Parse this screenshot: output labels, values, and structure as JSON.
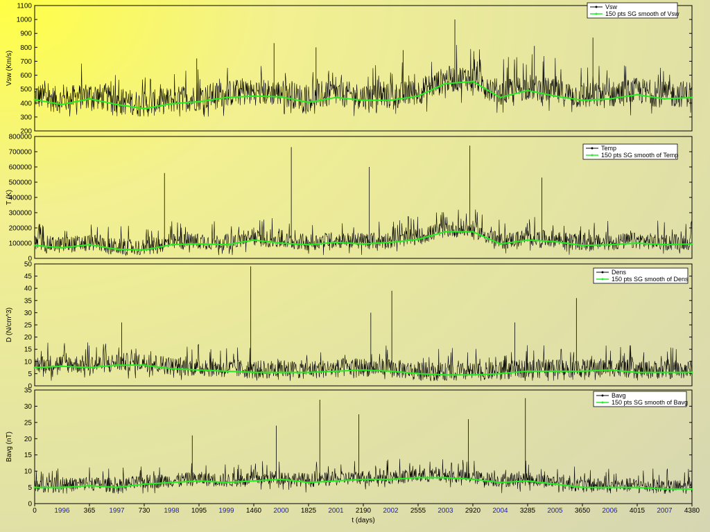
{
  "chart_data": {
    "type": "line",
    "x_axis": {
      "label": "t (days)",
      "range": [
        0,
        4380
      ],
      "ticks": [
        "0",
        "365",
        "730",
        "1095",
        "1460",
        "1825",
        "2190",
        "2555",
        "2920",
        "3285",
        "3650",
        "4015",
        "4380"
      ],
      "tick_values": [
        0,
        365,
        730,
        1095,
        1460,
        1825,
        2190,
        2555,
        2920,
        3285,
        3650,
        4015,
        4380
      ],
      "year_labels": [
        "1996",
        "1997",
        "1998",
        "1999",
        "2000",
        "2001",
        "2002",
        "2003",
        "2004",
        "2005",
        "2006",
        "2007"
      ],
      "year_values": [
        182.5,
        547.5,
        912.5,
        1277.5,
        1642.5,
        2007.5,
        2372.5,
        2737.5,
        3102.5,
        3467.5,
        3832.5,
        4197.5
      ]
    },
    "panels": [
      {
        "ylabel": "Vsw (Km/s)",
        "ylim": [
          200,
          1100
        ],
        "yticks": [
          "200",
          "300",
          "400",
          "500",
          "600",
          "700",
          "800",
          "900",
          "1000",
          "1100"
        ],
        "ytick_values": [
          200,
          300,
          400,
          500,
          600,
          700,
          800,
          900,
          1000,
          1100
        ],
        "legend": [
          "Vsw",
          "150 pts SG smooth of Vsw"
        ],
        "raw_band": {
          "min": 300,
          "max": 650
        },
        "spikes": [
          {
            "x": 1080,
            "y": 720
          },
          {
            "x": 1595,
            "y": 830
          },
          {
            "x": 1875,
            "y": 800
          },
          {
            "x": 2455,
            "y": 780
          },
          {
            "x": 2800,
            "y": 1000
          },
          {
            "x": 3330,
            "y": 810
          },
          {
            "x": 3720,
            "y": 870
          }
        ],
        "smooth": [
          [
            0,
            425
          ],
          [
            182,
            390
          ],
          [
            365,
            430
          ],
          [
            547,
            390
          ],
          [
            730,
            360
          ],
          [
            912,
            395
          ],
          [
            1095,
            410
          ],
          [
            1277,
            440
          ],
          [
            1460,
            450
          ],
          [
            1642,
            445
          ],
          [
            1825,
            405
          ],
          [
            2007,
            440
          ],
          [
            2190,
            420
          ],
          [
            2372,
            420
          ],
          [
            2555,
            450
          ],
          [
            2737,
            540
          ],
          [
            2920,
            555
          ],
          [
            3102,
            440
          ],
          [
            3285,
            490
          ],
          [
            3467,
            450
          ],
          [
            3650,
            420
          ],
          [
            3832,
            430
          ],
          [
            4015,
            460
          ],
          [
            4197,
            430
          ],
          [
            4380,
            440
          ]
        ]
      },
      {
        "ylabel": "T (K)",
        "ylim": [
          0,
          800000
        ],
        "yticks": [
          "0",
          "100000",
          "200000",
          "300000",
          "400000",
          "500000",
          "600000",
          "700000",
          "800000"
        ],
        "ytick_values": [
          0,
          100000,
          200000,
          300000,
          400000,
          500000,
          600000,
          700000,
          800000
        ],
        "legend": [
          "Temp",
          "150 pts SG smooth of Temp"
        ],
        "raw_band": {
          "min": 20000,
          "max": 220000
        },
        "spikes": [
          {
            "x": 865,
            "y": 560000
          },
          {
            "x": 1710,
            "y": 730000
          },
          {
            "x": 2230,
            "y": 600000
          },
          {
            "x": 2900,
            "y": 740000
          },
          {
            "x": 3380,
            "y": 530000
          }
        ],
        "smooth": [
          [
            0,
            85000
          ],
          [
            182,
            70000
          ],
          [
            365,
            90000
          ],
          [
            547,
            60000
          ],
          [
            730,
            55000
          ],
          [
            912,
            90000
          ],
          [
            1095,
            95000
          ],
          [
            1277,
            90000
          ],
          [
            1460,
            120000
          ],
          [
            1642,
            100000
          ],
          [
            1825,
            90000
          ],
          [
            2007,
            105000
          ],
          [
            2190,
            95000
          ],
          [
            2372,
            105000
          ],
          [
            2555,
            125000
          ],
          [
            2737,
            175000
          ],
          [
            2920,
            175000
          ],
          [
            3102,
            95000
          ],
          [
            3285,
            120000
          ],
          [
            3467,
            110000
          ],
          [
            3650,
            85000
          ],
          [
            3832,
            90000
          ],
          [
            4015,
            100000
          ],
          [
            4197,
            90000
          ],
          [
            4380,
            95000
          ]
        ]
      },
      {
        "ylabel": "D (N/cm^3)",
        "ylim": [
          0,
          50
        ],
        "yticks": [
          "0",
          "5",
          "10",
          "15",
          "20",
          "25",
          "30",
          "35",
          "40",
          "45",
          "50"
        ],
        "ytick_values": [
          0,
          5,
          10,
          15,
          20,
          25,
          30,
          35,
          40,
          45,
          50
        ],
        "legend": [
          "Dens",
          "150 pts SG smooth of Dens"
        ],
        "raw_band": {
          "min": 2,
          "max": 16
        },
        "spikes": [
          {
            "x": 1440,
            "y": 49
          },
          {
            "x": 2380,
            "y": 39
          },
          {
            "x": 2240,
            "y": 30
          },
          {
            "x": 3610,
            "y": 36
          },
          {
            "x": 580,
            "y": 26
          },
          {
            "x": 3200,
            "y": 26
          }
        ],
        "smooth": [
          [
            0,
            7.5
          ],
          [
            182,
            8
          ],
          [
            365,
            7.5
          ],
          [
            547,
            8.5
          ],
          [
            730,
            8.5
          ],
          [
            912,
            7
          ],
          [
            1095,
            6.5
          ],
          [
            1277,
            6
          ],
          [
            1460,
            5.5
          ],
          [
            1642,
            5.5
          ],
          [
            1825,
            5.5
          ],
          [
            2007,
            6
          ],
          [
            2190,
            6.5
          ],
          [
            2372,
            6
          ],
          [
            2555,
            5
          ],
          [
            2737,
            4.5
          ],
          [
            2920,
            4.5
          ],
          [
            3102,
            5
          ],
          [
            3285,
            6
          ],
          [
            3467,
            6
          ],
          [
            3650,
            6
          ],
          [
            3832,
            6.5
          ],
          [
            4015,
            5.5
          ],
          [
            4197,
            5.5
          ],
          [
            4380,
            5.5
          ]
        ]
      },
      {
        "ylabel": "Bavg (nT)",
        "ylim": [
          0,
          35
        ],
        "yticks": [
          "0",
          "5",
          "10",
          "15",
          "20",
          "25",
          "30",
          "35"
        ],
        "ytick_values": [
          0,
          5,
          10,
          15,
          20,
          25,
          30,
          35
        ],
        "legend": [
          "Bavg",
          "150 pts SG smooth of Bavg"
        ],
        "raw_band": {
          "min": 3,
          "max": 11
        },
        "spikes": [
          {
            "x": 1900,
            "y": 32
          },
          {
            "x": 3270,
            "y": 32.5
          },
          {
            "x": 2160,
            "y": 27.5
          },
          {
            "x": 1610,
            "y": 24
          },
          {
            "x": 2890,
            "y": 26
          },
          {
            "x": 1050,
            "y": 21
          }
        ],
        "smooth": [
          [
            0,
            5
          ],
          [
            182,
            5
          ],
          [
            365,
            5.5
          ],
          [
            547,
            5
          ],
          [
            730,
            6
          ],
          [
            912,
            6.5
          ],
          [
            1095,
            7
          ],
          [
            1277,
            6.5
          ],
          [
            1460,
            7
          ],
          [
            1642,
            7.5
          ],
          [
            1825,
            6.5
          ],
          [
            2007,
            7
          ],
          [
            2190,
            7.5
          ],
          [
            2372,
            7.5
          ],
          [
            2555,
            8
          ],
          [
            2737,
            8
          ],
          [
            2920,
            7.5
          ],
          [
            3102,
            6.5
          ],
          [
            3285,
            7
          ],
          [
            3467,
            6
          ],
          [
            3650,
            5
          ],
          [
            3832,
            5
          ],
          [
            4015,
            5
          ],
          [
            4197,
            4.5
          ],
          [
            4380,
            4.5
          ]
        ]
      }
    ],
    "colors": {
      "raw": "#000000",
      "smooth": "#22ee22",
      "year_label": "#1f1fa0",
      "background": "#eaea98"
    }
  }
}
